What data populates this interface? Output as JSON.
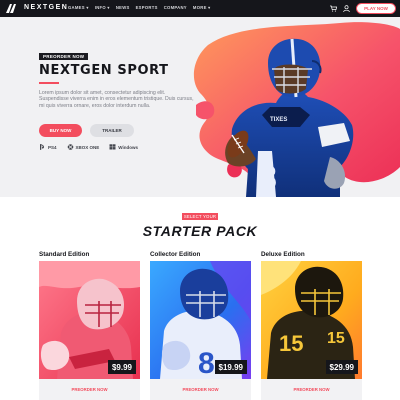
{
  "nav": {
    "brand": "NEXTGEN",
    "menu": [
      "GAMES ▾",
      "INFO ▾",
      "NEWS",
      "ESPORTS",
      "COMPANY",
      "MORE ▾"
    ],
    "cart_icon": "cart-icon",
    "user_icon": "user-icon",
    "play_now": "PLAY NOW"
  },
  "hero": {
    "badge": "PREORDER NOW",
    "title": "NEXTGEN SPORT",
    "description": "Lorem ipsum dolor sit amet, consectetur adipiscing elit. Suspendisse viverra enim in eros elementum tristique. Duis cursus, mi quis viverra ornare, eros dolor interdum nulla.",
    "buy_now": "BUY NOW",
    "trailer": "TRAILER",
    "platforms": [
      "PS4",
      "XBOX ONE",
      "Windows"
    ],
    "accent": "#f34d5e"
  },
  "starter": {
    "badge": "SELECT YOUR",
    "title": "STARTER PACK",
    "cards": [
      {
        "title": "Standard Edition",
        "price": "$9.99",
        "cta": "PREORDER NOW"
      },
      {
        "title": "Collector Edition",
        "price": "$19.99",
        "cta": "PREORDER NOW"
      },
      {
        "title": "Deluxe Edition",
        "price": "$29.99",
        "cta": "PREORDER NOW"
      }
    ]
  }
}
